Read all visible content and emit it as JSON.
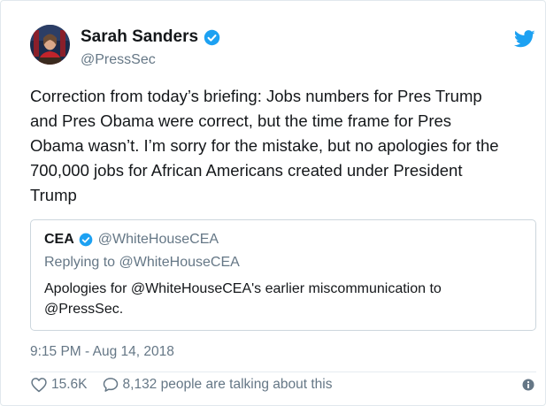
{
  "author": {
    "display_name": "Sarah Sanders",
    "handle": "@PressSec",
    "verified": true
  },
  "tweet": {
    "text": "Correction from today’s briefing: Jobs numbers for Pres Trump\nand Pres Obama were correct, but the time frame for Pres\nObama wasn’t. I’m sorry for the mistake, but no apologies for the\n700,000 jobs for African Americans created under President\nTrump",
    "timestamp": "9:15 PM - Aug 14, 2018",
    "likes": "15.6K",
    "talking": "8,132 people are talking about this"
  },
  "quoted": {
    "name": "CEA",
    "handle": "@WhiteHouseCEA",
    "reply_to": "Replying to @WhiteHouseCEA",
    "text": "Apologies for @WhiteHouseCEA's earlier miscommunication to\n@PressSec."
  },
  "icons": {
    "brand": "twitter-bird-icon",
    "verified": "verified-badge-icon",
    "like": "heart-icon",
    "reply": "speech-bubble-icon",
    "info": "info-icon"
  },
  "colors": {
    "accent": "#1da1f2",
    "text": "#14171a",
    "muted": "#657786",
    "border": "#ccd6dd"
  }
}
